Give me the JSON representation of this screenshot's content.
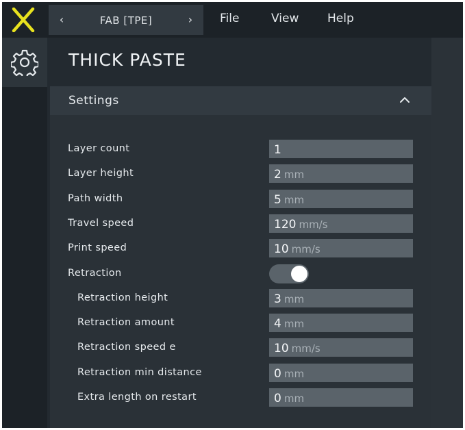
{
  "topbar": {
    "file_name": "FAB [TPE]",
    "prev_symbol": "‹",
    "next_symbol": "›",
    "menus": [
      "File",
      "View",
      "Help"
    ]
  },
  "colors": {
    "logo": "#e8e21f",
    "background": "#232a30",
    "input": "#5a636a"
  },
  "icons": {
    "logo": "x-logo-icon",
    "settings": "gear-icon",
    "collapse": "chevron-up-icon",
    "prev": "chevron-left-icon",
    "next": "chevron-right-icon"
  },
  "page": {
    "title": "THICK PASTE"
  },
  "section": {
    "title": "Settings",
    "expanded": true
  },
  "settings": [
    {
      "label": "Layer count",
      "value": "1",
      "unit": "",
      "indent": 0,
      "type": "number"
    },
    {
      "label": "Layer height",
      "value": "2",
      "unit": "mm",
      "indent": 0,
      "type": "number"
    },
    {
      "label": "Path width",
      "value": "5",
      "unit": "mm",
      "indent": 0,
      "type": "number"
    },
    {
      "label": "Travel speed",
      "value": "120",
      "unit": "mm/s",
      "indent": 0,
      "type": "number"
    },
    {
      "label": "Print speed",
      "value": "10",
      "unit": "mm/s",
      "indent": 0,
      "type": "number"
    },
    {
      "label": "Retraction",
      "value": "",
      "unit": "",
      "indent": 0,
      "type": "toggle",
      "checked": true
    },
    {
      "label": "Retraction height",
      "value": "3",
      "unit": "mm",
      "indent": 1,
      "type": "number"
    },
    {
      "label": "Retraction amount",
      "value": "4",
      "unit": "mm",
      "indent": 1,
      "type": "number"
    },
    {
      "label": "Retraction speed e",
      "value": "10",
      "unit": "mm/s",
      "indent": 1,
      "type": "number"
    },
    {
      "label": "Retraction min distance",
      "value": "0",
      "unit": "mm",
      "indent": 1,
      "type": "number"
    },
    {
      "label": "Extra length on restart",
      "value": "0",
      "unit": "mm",
      "indent": 1,
      "type": "number"
    }
  ]
}
